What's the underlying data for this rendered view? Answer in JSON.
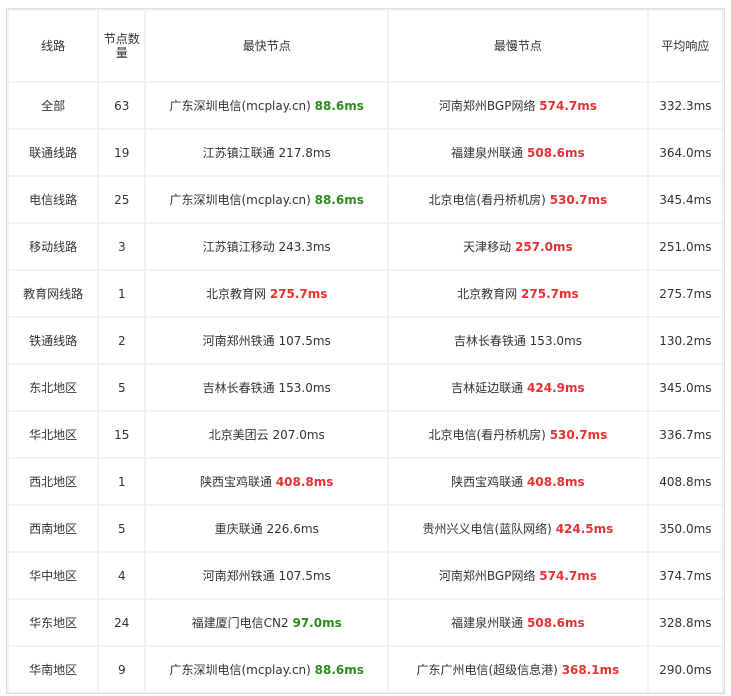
{
  "headers": [
    "线路",
    "节点数量",
    "最快节点",
    "最慢节点",
    "平均响应"
  ],
  "rows": [
    {
      "line": "全部",
      "count": "63",
      "fast_name": "广东深圳电信(mcplay.cn)",
      "fast_ms": "88.6ms",
      "fast_style": "fast",
      "slow_name": "河南郑州BGP网络",
      "slow_ms": "574.7ms",
      "slow_style": "slow",
      "avg": "332.3ms"
    },
    {
      "line": "联通线路",
      "count": "19",
      "fast_name": "江苏镇江联通",
      "fast_ms": "217.8ms",
      "fast_style": "plain",
      "slow_name": "福建泉州联通",
      "slow_ms": "508.6ms",
      "slow_style": "slow",
      "avg": "364.0ms"
    },
    {
      "line": "电信线路",
      "count": "25",
      "fast_name": "广东深圳电信(mcplay.cn)",
      "fast_ms": "88.6ms",
      "fast_style": "fast",
      "slow_name": "北京电信(看丹桥机房)",
      "slow_ms": "530.7ms",
      "slow_style": "slow",
      "avg": "345.4ms"
    },
    {
      "line": "移动线路",
      "count": "3",
      "fast_name": "江苏镇江移动",
      "fast_ms": "243.3ms",
      "fast_style": "plain",
      "slow_name": "天津移动",
      "slow_ms": "257.0ms",
      "slow_style": "slow",
      "avg": "251.0ms"
    },
    {
      "line": "教育网线路",
      "count": "1",
      "fast_name": "北京教育网",
      "fast_ms": "275.7ms",
      "fast_style": "slow",
      "slow_name": "北京教育网",
      "slow_ms": "275.7ms",
      "slow_style": "slow",
      "avg": "275.7ms"
    },
    {
      "line": "铁通线路",
      "count": "2",
      "fast_name": "河南郑州铁通",
      "fast_ms": "107.5ms",
      "fast_style": "plain",
      "slow_name": "吉林长春铁通",
      "slow_ms": "153.0ms",
      "slow_style": "plain",
      "avg": "130.2ms"
    },
    {
      "line": "东北地区",
      "count": "5",
      "fast_name": "吉林长春铁通",
      "fast_ms": "153.0ms",
      "fast_style": "plain",
      "slow_name": "吉林延边联通",
      "slow_ms": "424.9ms",
      "slow_style": "slow",
      "avg": "345.0ms"
    },
    {
      "line": "华北地区",
      "count": "15",
      "fast_name": "北京美团云",
      "fast_ms": "207.0ms",
      "fast_style": "plain",
      "slow_name": "北京电信(看丹桥机房)",
      "slow_ms": "530.7ms",
      "slow_style": "slow",
      "avg": "336.7ms"
    },
    {
      "line": "西北地区",
      "count": "1",
      "fast_name": "陕西宝鸡联通",
      "fast_ms": "408.8ms",
      "fast_style": "slow",
      "slow_name": "陕西宝鸡联通",
      "slow_ms": "408.8ms",
      "slow_style": "slow",
      "avg": "408.8ms"
    },
    {
      "line": "西南地区",
      "count": "5",
      "fast_name": "重庆联通",
      "fast_ms": "226.6ms",
      "fast_style": "plain",
      "slow_name": "贵州兴义电信(蓝队网络)",
      "slow_ms": "424.5ms",
      "slow_style": "slow",
      "avg": "350.0ms"
    },
    {
      "line": "华中地区",
      "count": "4",
      "fast_name": "河南郑州铁通",
      "fast_ms": "107.5ms",
      "fast_style": "plain",
      "slow_name": "河南郑州BGP网络",
      "slow_ms": "574.7ms",
      "slow_style": "slow",
      "avg": "374.7ms"
    },
    {
      "line": "华东地区",
      "count": "24",
      "fast_name": "福建厦门电信CN2",
      "fast_ms": "97.0ms",
      "fast_style": "fast",
      "slow_name": "福建泉州联通",
      "slow_ms": "508.6ms",
      "slow_style": "slow",
      "avg": "328.8ms"
    },
    {
      "line": "华南地区",
      "count": "9",
      "fast_name": "广东深圳电信(mcplay.cn)",
      "fast_ms": "88.6ms",
      "fast_style": "fast",
      "slow_name": "广东广州电信(超级信息港)",
      "slow_ms": "368.1ms",
      "slow_style": "slow",
      "avg": "290.0ms"
    }
  ],
  "colors": {
    "fast": "#2e8b1e",
    "slow": "#e53333",
    "text": "#333333",
    "border": "#dcdcdc",
    "gap": "#f2f2f2"
  }
}
